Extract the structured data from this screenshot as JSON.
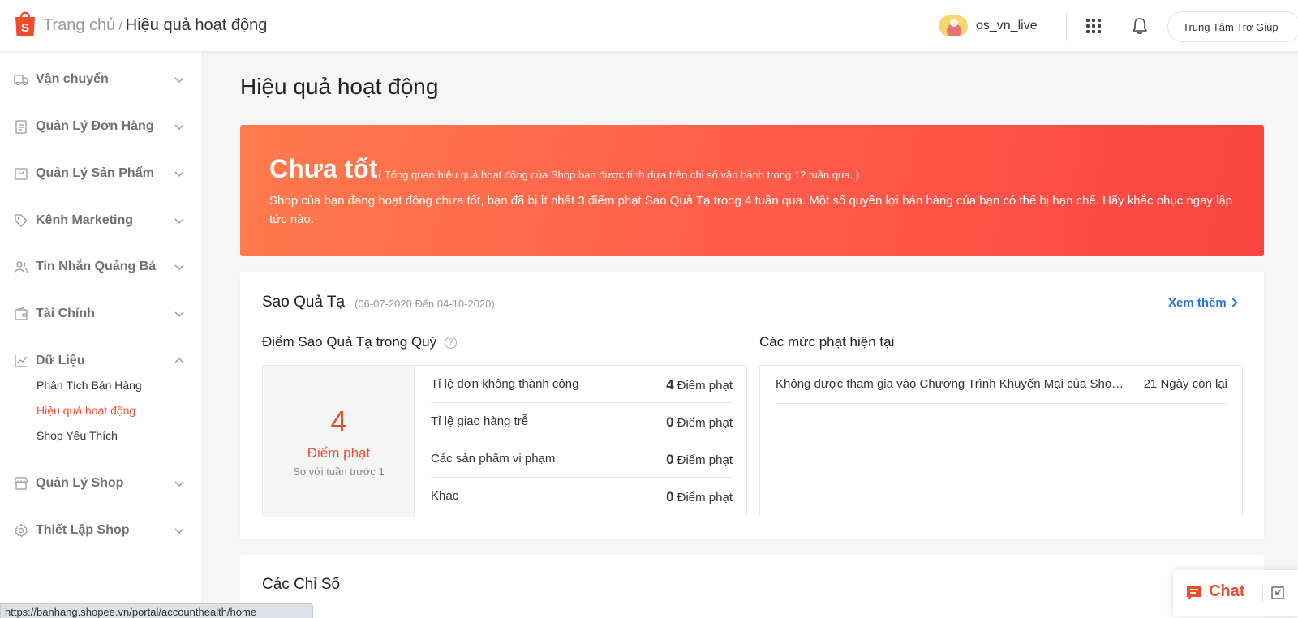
{
  "header": {
    "breadcrumb_home": "Trang chủ",
    "breadcrumb_sep": "/",
    "breadcrumb_current": "Hiệu quả hoạt động",
    "username": "os_vn_live",
    "help_label": "Trung Tâm Trợ Giúp",
    "icons": [
      "shopee-logo-icon",
      "apps-grid-icon",
      "bell-icon"
    ]
  },
  "sidebar": {
    "items": [
      {
        "label": "Vận chuyển",
        "icon": "truck-icon"
      },
      {
        "label": "Quản Lý Đơn Hàng",
        "icon": "clipboard-icon"
      },
      {
        "label": "Quản Lý Sản Phẩm",
        "icon": "bag-icon"
      },
      {
        "label": "Kênh Marketing",
        "icon": "tag-icon"
      },
      {
        "label": "Tin Nhắn Quảng Bá",
        "icon": "users-icon"
      },
      {
        "label": "Tài Chính",
        "icon": "wallet-icon"
      },
      {
        "label": "Dữ Liệu",
        "icon": "chart-line-icon"
      },
      {
        "label": "Quản Lý Shop",
        "icon": "store-icon"
      },
      {
        "label": "Thiết Lập Shop",
        "icon": "gear-icon"
      }
    ],
    "data_subitems": [
      "Phân Tích Bán Hàng",
      "Hiệu quả hoạt động",
      "Shop Yêu Thích"
    ],
    "active_subitem": "Hiệu quả hoạt động"
  },
  "main": {
    "title": "Hiệu quả hoạt động",
    "banner": {
      "status": "Chưa tốt",
      "note": "( Tổng quan hiệu quả hoạt động của Shop bạn được tính dựa trên chỉ số vận hành trong 12 tuần qua. )",
      "description": "Shop của bạn đang hoạt động chưa tốt, bạn đã bị ít nhất 3 điểm phạt Sao Quả Tạ trong 4 tuần qua. Một số quyền lợi bán hàng của bạn có thể bị hạn chế. Hãy khắc phục ngay lập tức nào."
    },
    "penalty_card": {
      "title": "Sao Quả Tạ",
      "date_range": "(06-07-2020 Đến 04-10-2020)",
      "see_more": "Xem thêm",
      "points_title": "Điểm Sao Quả Tạ trong Quý",
      "total_points": "4",
      "points_unit": "Điểm phạt",
      "comparison": "So với tuần trước 1",
      "breakdown": [
        {
          "label": "Tỉ lệ đơn không thành công",
          "value": "4",
          "unit": "Điểm phạt"
        },
        {
          "label": "Tỉ lệ giao hàng trễ",
          "value": "0",
          "unit": "Điểm phạt"
        },
        {
          "label": "Các sản phẩm vi phạm",
          "value": "0",
          "unit": "Điểm phạt"
        },
        {
          "label": "Khác",
          "value": "0",
          "unit": "Điểm phạt"
        }
      ],
      "current_penalties_title": "Các mức phạt hiện tại",
      "current_penalties": [
        {
          "label": "Không được tham gia vào Chương Trình Khuyến Mại của Shopee",
          "days_left": "21 Ngày còn lại"
        }
      ]
    },
    "metrics_card": {
      "title": "Các Chỉ Số"
    }
  },
  "chat": {
    "label": "Chat"
  },
  "status_url": "https://banhang.shopee.vn/portal/accounthealth/home",
  "colors": {
    "accent": "#ee4d2d",
    "link": "#2673dd",
    "banner_start": "#ff7b4d",
    "banner_end": "#f94440"
  }
}
